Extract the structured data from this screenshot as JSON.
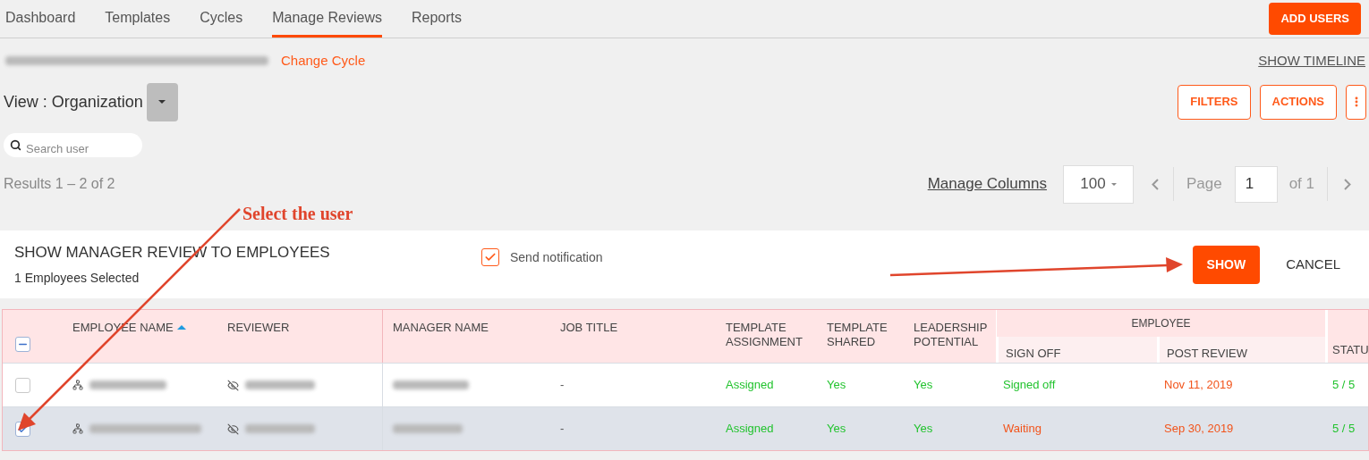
{
  "nav": {
    "tabs": [
      {
        "label": "Dashboard",
        "selected": false
      },
      {
        "label": "Templates",
        "selected": false
      },
      {
        "label": "Cycles",
        "selected": false
      },
      {
        "label": "Manage Reviews",
        "selected": true
      },
      {
        "label": "Reports",
        "selected": false
      }
    ],
    "add_users": "ADD USERS"
  },
  "cycle": {
    "change": "Change Cycle",
    "show_timeline": "SHOW TIMELINE"
  },
  "view": {
    "label": "View : Organization"
  },
  "toolbar": {
    "buttons": [
      "FILTERS",
      "ACTIONS"
    ]
  },
  "search": {
    "placeholder": "Search user"
  },
  "results": "Results 1 – 2 of 2",
  "pager": {
    "manage_columns": "Manage Columns",
    "page_size": "100",
    "page_label": "Page",
    "page": "1",
    "of": "of 1"
  },
  "bulk_bar": {
    "title": "SHOW MANAGER REVIEW TO EMPLOYEES",
    "subtitle": "1 Employees Selected",
    "notify": {
      "label": "Send notification",
      "checked": true
    },
    "show": "SHOW",
    "cancel": "CANCEL"
  },
  "table": {
    "select_all": {
      "indeterminate": true
    },
    "group": {
      "label": "EMPLOYEE"
    },
    "columns": [
      {
        "label": "EMPLOYEE NAME",
        "sorted": true
      },
      {
        "label": "REVIEWER",
        "sorted": false
      },
      {
        "label": "MANAGER NAME",
        "sorted": false
      },
      {
        "label": "JOB TITLE",
        "sorted": false
      },
      {
        "label": "TEMPLATE ASSIGNMENT",
        "sorted": false
      },
      {
        "label": "TEMPLATE SHARED",
        "sorted": false
      },
      {
        "label": "LEADERSHIP POTENTIAL",
        "sorted": false
      },
      {
        "label": "SIGN OFF",
        "sorted": false
      },
      {
        "label": "POST REVIEW",
        "sorted": false
      },
      {
        "label": "STATU",
        "sorted": false
      }
    ],
    "rows": [
      {
        "selected": false,
        "cells": [
          {
            "kind": "redacted"
          },
          {
            "kind": "redacted"
          },
          {
            "kind": "redacted"
          },
          {
            "kind": "text",
            "text": "-",
            "warning": false
          },
          {
            "kind": "text",
            "text": "Assigned",
            "warning": false
          },
          {
            "kind": "text",
            "text": "Yes",
            "warning": false
          },
          {
            "kind": "text",
            "text": "Yes",
            "warning": false
          },
          {
            "kind": "text",
            "text": "Signed off",
            "warning": false
          },
          {
            "kind": "text",
            "text": "Nov 11, 2019",
            "warning": true
          },
          {
            "kind": "text",
            "text": "5 / 5",
            "warning": false
          }
        ]
      },
      {
        "selected": true,
        "cells": [
          {
            "kind": "redacted"
          },
          {
            "kind": "redacted"
          },
          {
            "kind": "redacted"
          },
          {
            "kind": "text",
            "text": "-",
            "warning": false
          },
          {
            "kind": "text",
            "text": "Assigned",
            "warning": false
          },
          {
            "kind": "text",
            "text": "Yes",
            "warning": false
          },
          {
            "kind": "text",
            "text": "Yes",
            "warning": false
          },
          {
            "kind": "text",
            "text": "Waiting",
            "warning": true
          },
          {
            "kind": "text",
            "text": "Sep 30, 2019",
            "warning": true
          },
          {
            "kind": "text",
            "text": "5 / 5",
            "warning": false
          }
        ]
      }
    ]
  },
  "annotation": {
    "text": "Select the user"
  }
}
